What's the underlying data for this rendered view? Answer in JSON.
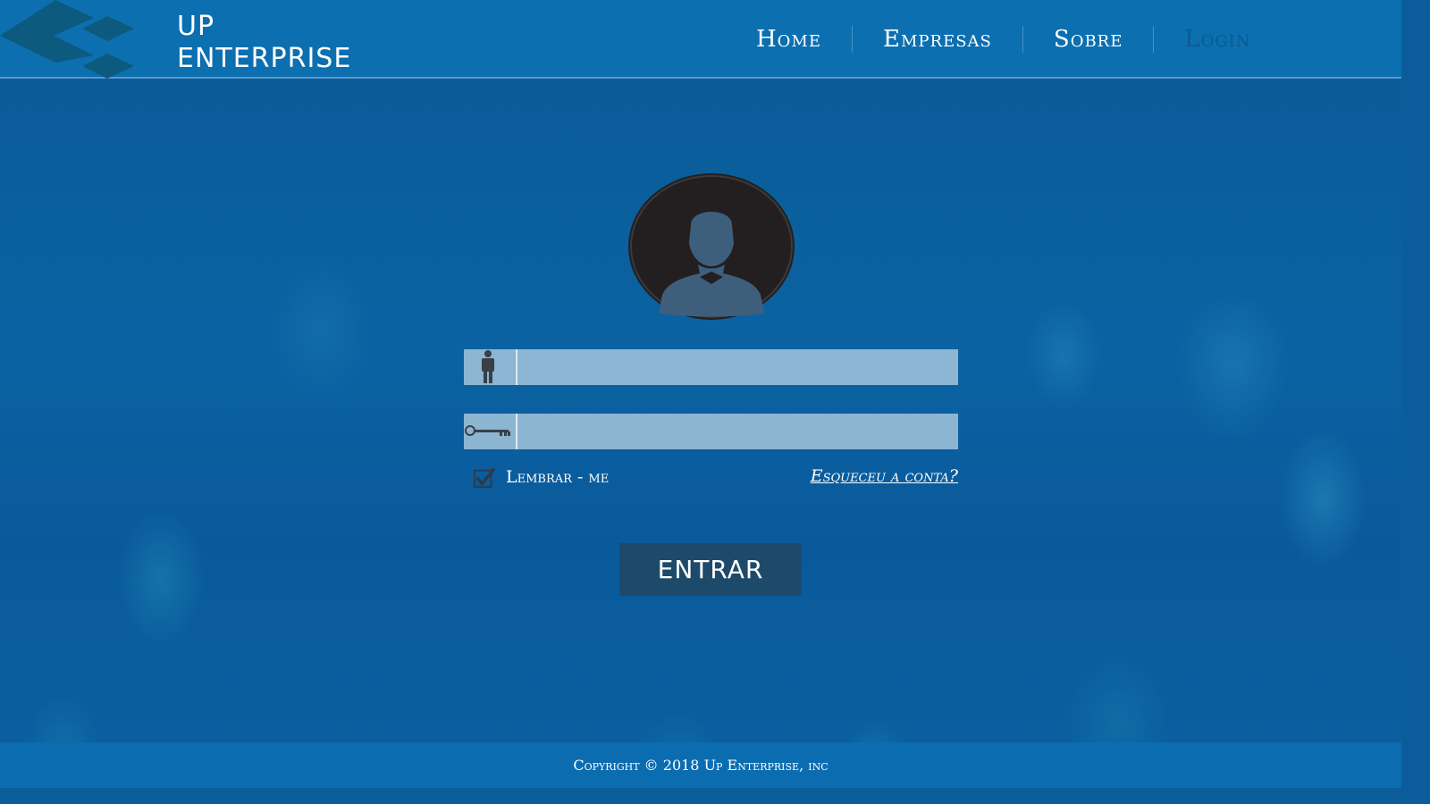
{
  "brand": {
    "line1": "UP",
    "line2": "ENTERPRISE",
    "logo_icon": "diamond-chevron-logo"
  },
  "nav": {
    "items": [
      {
        "label": "Home"
      },
      {
        "label": "Empresas"
      },
      {
        "label": "Sobre"
      },
      {
        "label": "Login",
        "active": true
      }
    ]
  },
  "login": {
    "avatar_icon": "user-avatar-icon",
    "username": {
      "icon": "person-icon",
      "value": "",
      "placeholder": ""
    },
    "password": {
      "icon": "key-icon",
      "value": "",
      "placeholder": ""
    },
    "remember": {
      "label": "Lembrar - me",
      "checked": true
    },
    "forgot_label": "Esqueceu a conta?",
    "submit_label": "ENTRAR"
  },
  "footer": {
    "copyright": "Copyright © 2018 Up Enterprise, inc"
  },
  "colors": {
    "header": "#0b6fb0",
    "button": "#1d4a6b",
    "active_nav": "#0f5a8c",
    "avatar": "#231f20"
  }
}
